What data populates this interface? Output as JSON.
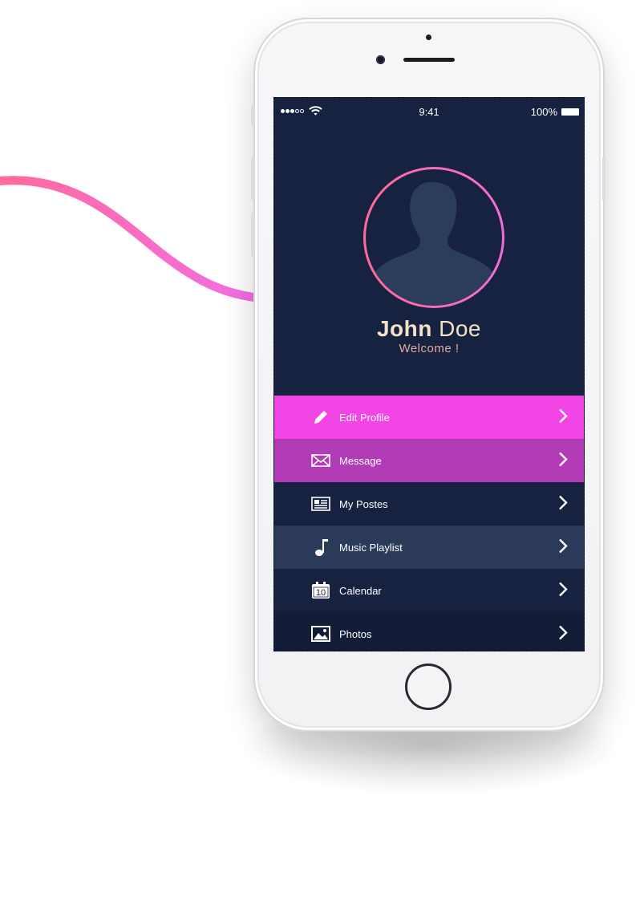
{
  "status_bar": {
    "time": "9:41",
    "battery": "100%",
    "signal_icon": "signal-dots-icon",
    "wifi_icon": "wifi-icon"
  },
  "profile": {
    "first_name": "John",
    "last_name": "Doe",
    "greeting": "Welcome !",
    "avatar_icon": "user-silhouette-icon"
  },
  "menu": {
    "items": [
      {
        "label": "Edit Profile",
        "icon": "pencil-icon",
        "background": "#f345e6"
      },
      {
        "label": "Message",
        "icon": "envelope-icon",
        "background": "#b23bb6"
      },
      {
        "label": "My Postes",
        "icon": "newspaper-icon",
        "background": "#172240"
      },
      {
        "label": "Music Playlist",
        "icon": "music-note-icon",
        "background": "#2a3a58"
      },
      {
        "label": "Calendar",
        "icon": "calendar-icon",
        "background": "#172240",
        "icon_text": "10"
      },
      {
        "label": "Photos",
        "icon": "photo-icon",
        "background": "#141d38"
      }
    ]
  },
  "colors": {
    "screen_background": "#172240",
    "accent_gradient_start": "#ff6b9a",
    "accent_gradient_end": "#f26dd6",
    "name_color": "#f3e2c8",
    "greeting_color": "#e9a99e"
  }
}
